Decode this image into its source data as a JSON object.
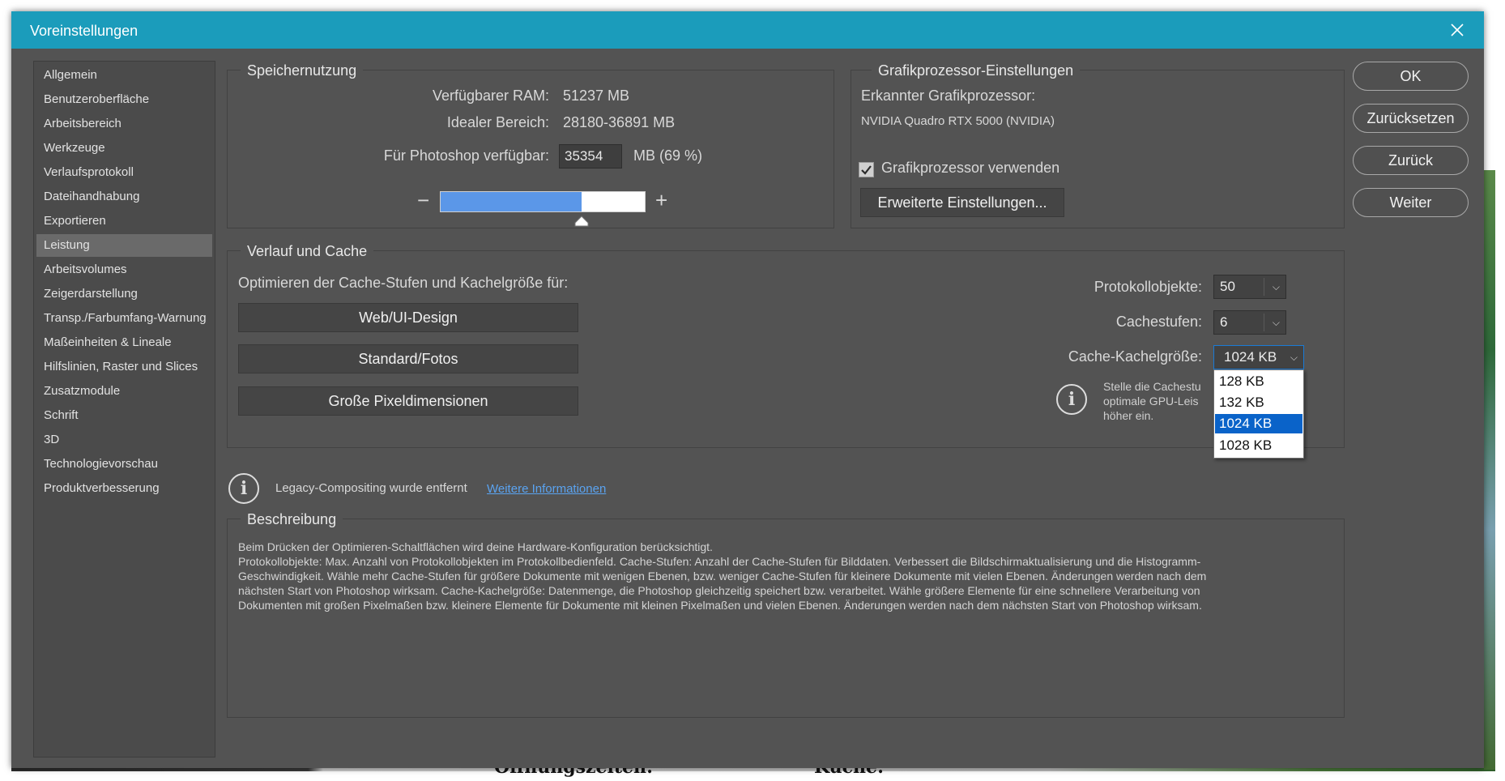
{
  "window": {
    "title": "Voreinstellungen"
  },
  "sidebar": {
    "items": [
      {
        "label": "Allgemein"
      },
      {
        "label": "Benutzeroberfläche"
      },
      {
        "label": "Arbeitsbereich"
      },
      {
        "label": "Werkzeuge"
      },
      {
        "label": "Verlaufsprotokoll"
      },
      {
        "label": "Dateihandhabung"
      },
      {
        "label": "Exportieren"
      },
      {
        "label": "Leistung"
      },
      {
        "label": "Arbeitsvolumes"
      },
      {
        "label": "Zeigerdarstellung"
      },
      {
        "label": "Transp./Farbumfang-Warnung"
      },
      {
        "label": "Maßeinheiten & Lineale"
      },
      {
        "label": "Hilfslinien, Raster und Slices"
      },
      {
        "label": "Zusatzmodule"
      },
      {
        "label": "Schrift"
      },
      {
        "label": "3D"
      },
      {
        "label": "Technologievorschau"
      },
      {
        "label": "Produktverbesserung"
      }
    ],
    "active": "Leistung"
  },
  "memory": {
    "title": "Speichernutzung",
    "ram_label": "Verfügbarer RAM:",
    "ram_value": "51237 MB",
    "ideal_label": "Idealer Bereich:",
    "ideal_value": "28180-36891 MB",
    "ps_label": "Für Photoshop verfügbar:",
    "ps_value": "35354",
    "ps_unit": "MB (69 %)",
    "slider_fraction": 0.69,
    "minus": "−",
    "plus": "+"
  },
  "gpu": {
    "title": "Grafikprozessor-Einstellungen",
    "detected_label": "Erkannter Grafikprozessor:",
    "detected_value": "NVIDIA Quadro RTX 5000 (NVIDIA)",
    "use_label": "Grafikprozessor verwenden",
    "use_checked": true,
    "advanced_button": "Erweiterte Einstellungen..."
  },
  "cache": {
    "title": "Verlauf und Cache",
    "optimize_label": "Optimieren der Cache-Stufen und Kachelgröße für:",
    "buttons": [
      "Web/UI-Design",
      "Standard/Fotos",
      "Große Pixeldimensionen"
    ],
    "history_label": "Protokollobjekte:",
    "history_value": "50",
    "levels_label": "Cachestufen:",
    "levels_value": "6",
    "tile_label": "Cache-Kachelgröße:",
    "tile_value": "1024 KB",
    "tile_options": [
      "128 KB",
      "132 KB",
      "1024 KB",
      "1028 KB"
    ],
    "tile_selected": "1024 KB",
    "hint_lines": [
      "Stelle die Cachestu",
      "optimale GPU-Leis",
      "höher ein."
    ]
  },
  "legacy": {
    "text": "Legacy-Compositing wurde entfernt",
    "link": "Weitere Informationen"
  },
  "description": {
    "title": "Beschreibung",
    "lines": [
      "Beim Drücken der Optimieren-Schaltflächen wird deine Hardware-Konfiguration berücksichtigt.",
      "Protokollobjekte: Max. Anzahl von Protokollobjekten im Protokollbedienfeld. Cache-Stufen: Anzahl der Cache-Stufen für Bilddaten. Verbessert die Bildschirmaktualisierung und die Histogramm-",
      "Geschwindigkeit. Wähle mehr Cache-Stufen für größere Dokumente mit wenigen Ebenen, bzw. weniger Cache-Stufen für kleinere Dokumente mit vielen Ebenen. Änderungen werden nach dem",
      "nächsten Start von Photoshop wirksam. Cache-Kachelgröße: Datenmenge, die Photoshop gleichzeitig speichert bzw. verarbeitet. Wähle größere Elemente für eine schnellere Verarbeitung von",
      "Dokumenten mit großen Pixelmaßen bzw. kleinere Elemente für Dokumente mit kleinen Pixelmaßen und vielen Ebenen. Änderungen werden nach dem nächsten Start von Photoshop wirksam."
    ]
  },
  "actions": {
    "ok": "OK",
    "reset": "Zurücksetzen",
    "back": "Zurück",
    "next": "Weiter"
  },
  "background": {
    "text_left": "Öffnungszeiten:",
    "text_right": "Küche:"
  },
  "icons": {
    "close": "close-icon",
    "info": "info-icon",
    "chevron": "chevron-down-icon",
    "check": "check-icon"
  }
}
